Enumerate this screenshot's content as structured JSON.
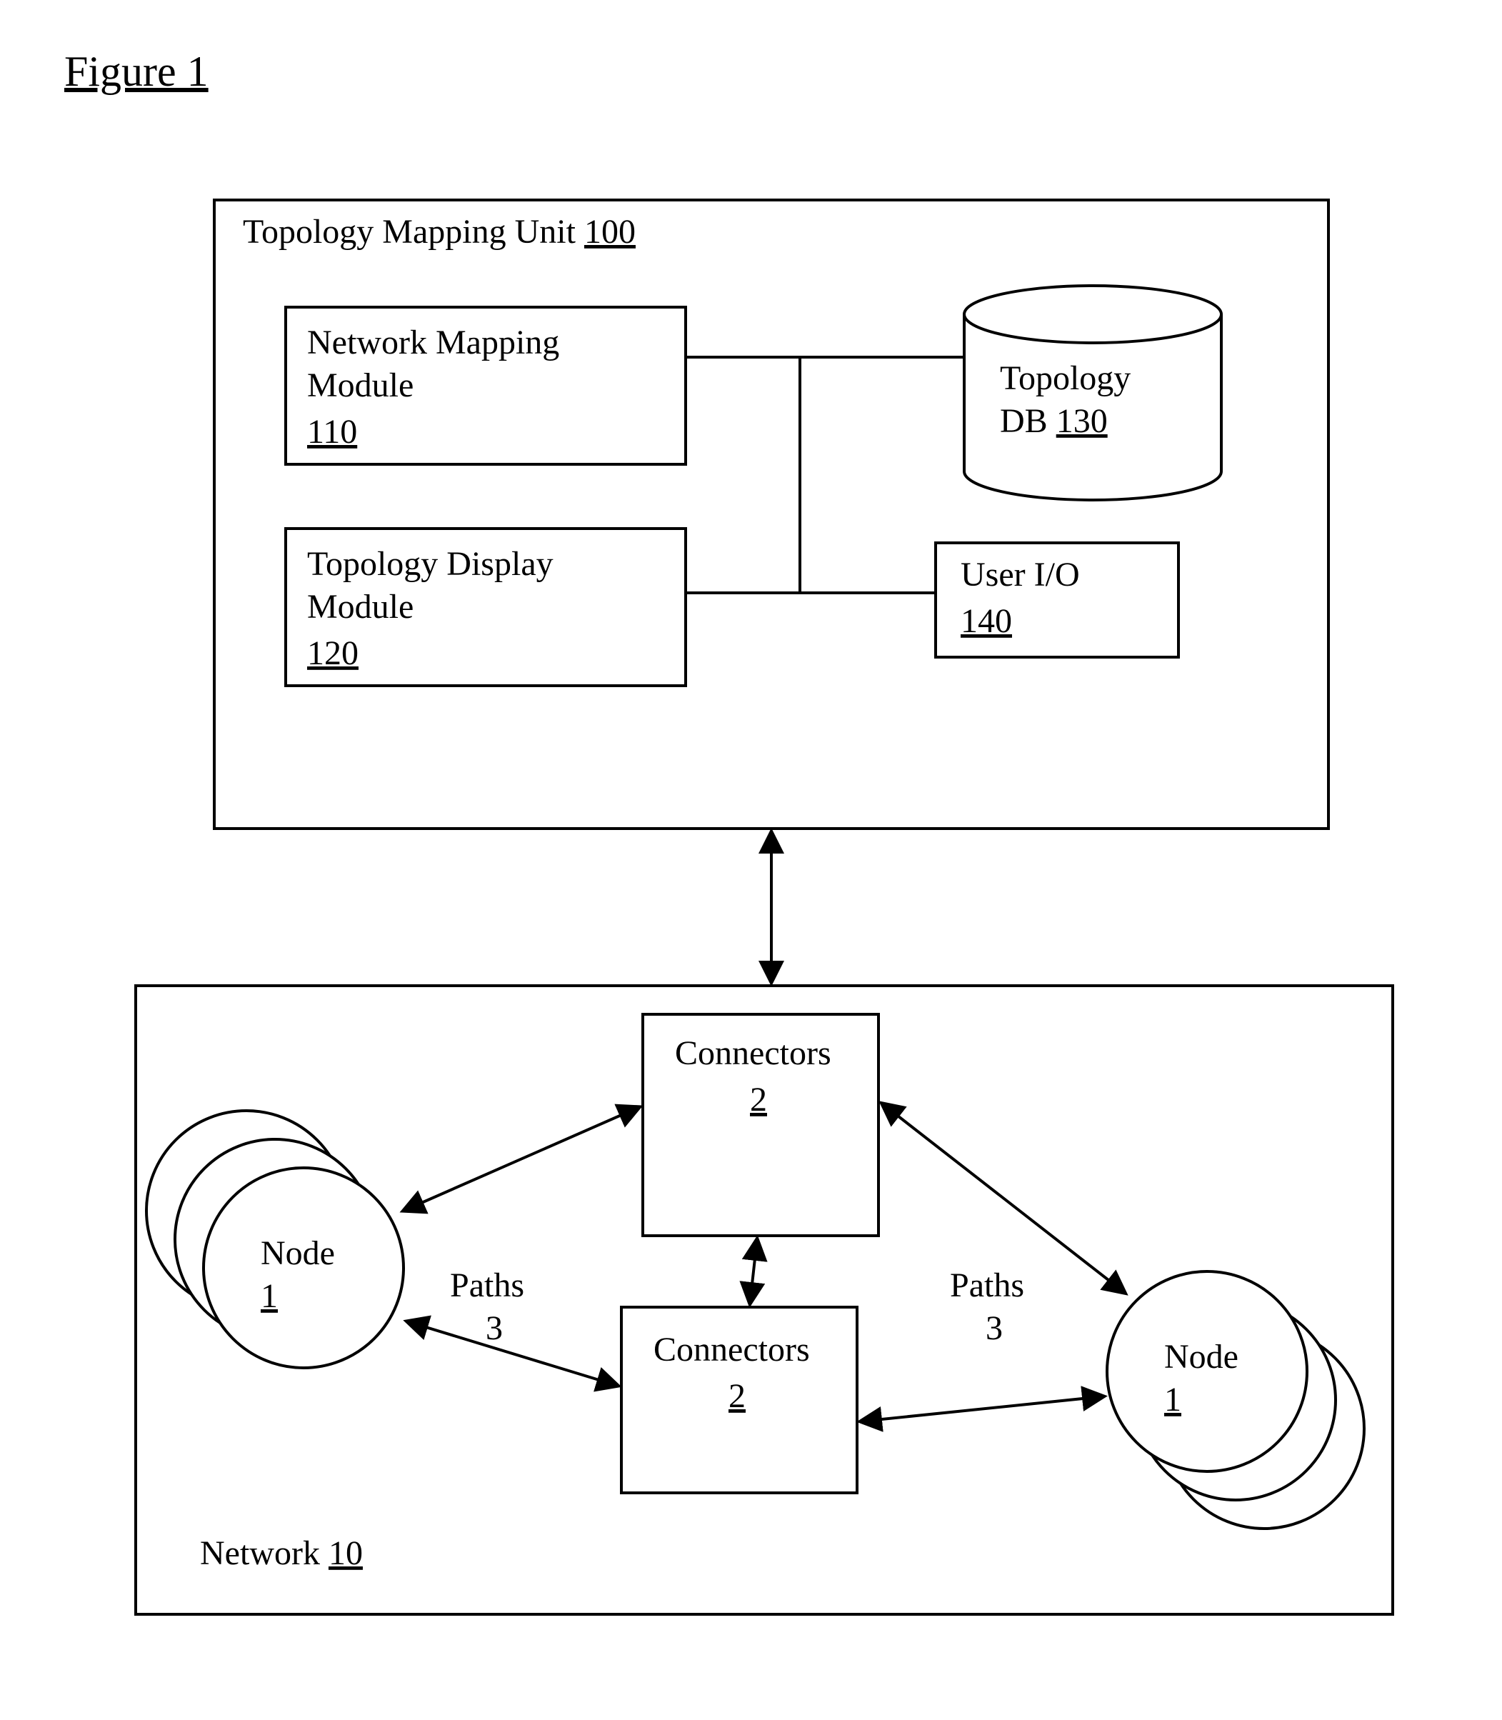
{
  "figure_title": "Figure 1",
  "topology_unit": {
    "title_text": "Topology Mapping Unit ",
    "title_ref": "100",
    "network_mapping": {
      "line1": "Network Mapping",
      "line2": "Module",
      "ref": "110"
    },
    "topology_display": {
      "line1": "Topology Display",
      "line2": "Module",
      "ref": "120"
    },
    "db": {
      "line1": "Topology",
      "line2_prefix": "DB ",
      "ref": "130"
    },
    "user_io": {
      "line1": "User I/O",
      "ref": "140"
    }
  },
  "network": {
    "title_text": "Network ",
    "title_ref": "10",
    "node_left": {
      "label": "Node",
      "ref": "1"
    },
    "node_right": {
      "label": "Node",
      "ref": "1"
    },
    "connectors_top": {
      "label": "Connectors",
      "ref": "2"
    },
    "connectors_bottom": {
      "label": "Connectors",
      "ref": "2"
    },
    "paths_left": {
      "label": "Paths",
      "num": "3"
    },
    "paths_right": {
      "label": "Paths",
      "num": "3"
    }
  }
}
